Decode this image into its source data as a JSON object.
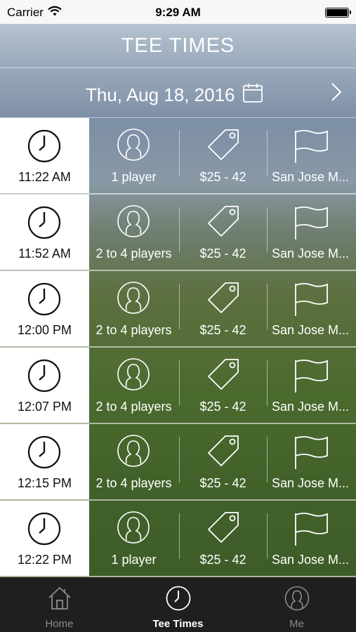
{
  "status_bar": {
    "carrier": "Carrier",
    "time": "9:29 AM"
  },
  "header": {
    "title": "TEE TIMES",
    "date": "Thu, Aug 18, 2016"
  },
  "tee_times": [
    {
      "time": "11:22 AM",
      "players": "1 player",
      "price": "$25 - 42",
      "course": "San Jose M..."
    },
    {
      "time": "11:52 AM",
      "players": "2 to 4 players",
      "price": "$25 - 42",
      "course": "San Jose M..."
    },
    {
      "time": "12:00 PM",
      "players": "2 to 4 players",
      "price": "$25 - 42",
      "course": "San Jose M..."
    },
    {
      "time": "12:07 PM",
      "players": "2 to 4 players",
      "price": "$25 - 42",
      "course": "San Jose M..."
    },
    {
      "time": "12:15 PM",
      "players": "2 to 4 players",
      "price": "$25 - 42",
      "course": "San Jose M..."
    },
    {
      "time": "12:22 PM",
      "players": "1 player",
      "price": "$25 - 42",
      "course": "San Jose M..."
    }
  ],
  "tab_bar": {
    "tabs": [
      {
        "label": "Home",
        "icon": "home-icon",
        "active": false
      },
      {
        "label": "Tee Times",
        "icon": "clock-icon",
        "active": true
      },
      {
        "label": "Me",
        "icon": "person-icon",
        "active": false
      }
    ]
  },
  "colors": {
    "status_bar_bg": "#f7f7f7",
    "tab_bar_bg": "#1f1f1f",
    "active_tab": "#ffffff",
    "inactive_tab": "#8b8b8b"
  }
}
